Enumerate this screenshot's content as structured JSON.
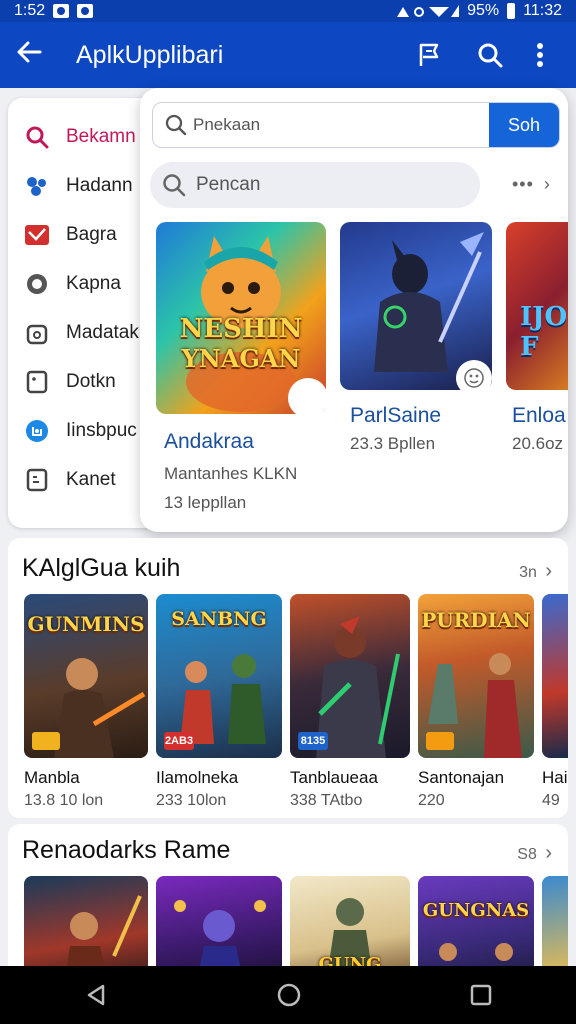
{
  "status": {
    "time_left": "1:52",
    "battery": "95%",
    "time_right": "11:32"
  },
  "appbar": {
    "title": "AplkUpplibari"
  },
  "drawer": {
    "items": [
      {
        "label": "Bekamn"
      },
      {
        "label": "Hadann"
      },
      {
        "label": "Bagra"
      },
      {
        "label": "Kapna"
      },
      {
        "label": "Madatak"
      },
      {
        "label": "Dotkn"
      },
      {
        "label": "Iinsbpuc"
      },
      {
        "label": "Kanet"
      }
    ]
  },
  "popup": {
    "search_value": "Pnekaan",
    "search_button": "Soh",
    "pill_text": "Pencan",
    "more": "•••",
    "cards": [
      {
        "art_line1": "NESHIN",
        "art_line2": "YNAGAN",
        "title": "Andakraa",
        "sub1": "Mantanhes KLKN",
        "sub2": "13 leppllan"
      },
      {
        "title": "ParlSaine",
        "sub1": "23.3 Bpllen"
      },
      {
        "art_text": "IJO F",
        "title": "Enloa",
        "sub1": "20.6oz"
      }
    ]
  },
  "section1": {
    "title": "KAlglGua kuih",
    "more": "3n",
    "tiles": [
      {
        "art": "GUNMINS",
        "badge": "",
        "name": "Manbla",
        "sub": "13.8 10 lon"
      },
      {
        "art": "SANBNG",
        "badge": "2AB3",
        "name": "Ilamolneka",
        "sub": "233 10lon"
      },
      {
        "art": "",
        "badge": "8135",
        "name": "Tanblaueaa",
        "sub": "338 TAtbo"
      },
      {
        "art": "PURDIAN",
        "badge": "",
        "name": "Santonajan",
        "sub": "220"
      },
      {
        "art": "",
        "badge": "",
        "name": "Hai",
        "sub": "49"
      }
    ]
  },
  "section2": {
    "title": "Renaodarks Rame",
    "more": "S8",
    "tiles": [
      {
        "art": ""
      },
      {
        "art": ""
      },
      {
        "art": "GUNG VANS"
      },
      {
        "art": "GUNGNAS"
      },
      {
        "art": ""
      }
    ]
  },
  "colors": {
    "appbar": "#0d47c1",
    "accent": "#1565d8",
    "active": "#c2185b",
    "link": "#1a4f9c"
  }
}
